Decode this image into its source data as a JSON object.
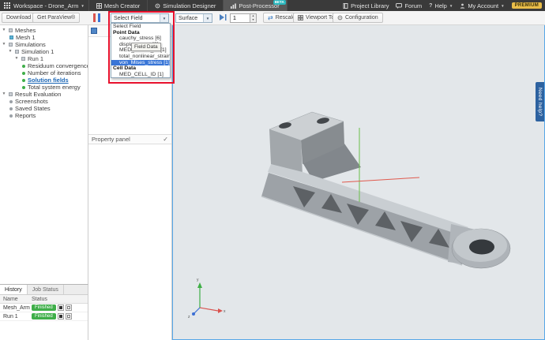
{
  "colors": {
    "accent_blue": "#3875d7",
    "finished_green": "#3fae49",
    "annotation_red": "#e8112d",
    "beta_teal": "#29b6bd",
    "premium_gold": "#e9bd4a",
    "viewport_bg": "#e3e7ea",
    "need_help_blue": "#2d62a0"
  },
  "topbar": {
    "workspace": "Workspace - Drone_Arm",
    "tabs": [
      {
        "label": "Mesh Creator"
      },
      {
        "label": "Simulation Designer"
      },
      {
        "label": "Post-Processor",
        "badge": "BETA"
      }
    ],
    "right": {
      "project_library": "Project Library",
      "forum": "Forum",
      "help": "Help",
      "my_account": "My Account",
      "premium": "PREMIUM"
    }
  },
  "toolbar": {
    "download": "Download",
    "get_paraview": "Get ParaView®",
    "field_select": "Select Field",
    "representation": "Surface",
    "frame": "1",
    "rescale": "Rescale",
    "viewport_tools": "Viewport Tools",
    "configuration": "Configuration"
  },
  "tree": {
    "items": [
      {
        "label": "Meshes"
      },
      {
        "label": "Mesh 1"
      },
      {
        "label": "Simulations"
      },
      {
        "label": "Simulation 1"
      },
      {
        "label": "Run 1"
      },
      {
        "label": "Residuum convergence plot"
      },
      {
        "label": "Number of iterations"
      },
      {
        "label": "Solution fields"
      },
      {
        "label": "Total system energy"
      },
      {
        "label": "Result Evaluation"
      },
      {
        "label": "Screenshots"
      },
      {
        "label": "Saved States"
      },
      {
        "label": "Reports"
      }
    ]
  },
  "dropdown": {
    "value": "Select Field",
    "items": [
      {
        "label": "Select Field"
      },
      {
        "label": "Point Data"
      },
      {
        "label": "cauchy_stress [6]"
      },
      {
        "label": "displacement [3]"
      },
      {
        "label": "MED_POINT_ID [1]"
      },
      {
        "label": "total_nonlinear_strain [6]"
      },
      {
        "label": "von_Mises_stress [1]"
      },
      {
        "label": "Cell Data"
      },
      {
        "label": "MED_CELL_ID [1]"
      }
    ],
    "tooltip": "Field Data"
  },
  "property_panel": {
    "title": "Property panel"
  },
  "history": {
    "tabs": [
      {
        "label": "History"
      },
      {
        "label": "Job Status"
      }
    ],
    "columns": [
      {
        "label": "Name"
      },
      {
        "label": "Status"
      }
    ],
    "rows": [
      {
        "name": "Mesh_Arm",
        "status": "Finished"
      },
      {
        "name": "Run 1",
        "status": "Finished"
      }
    ]
  },
  "viewport": {
    "need_help": "Need help?"
  }
}
